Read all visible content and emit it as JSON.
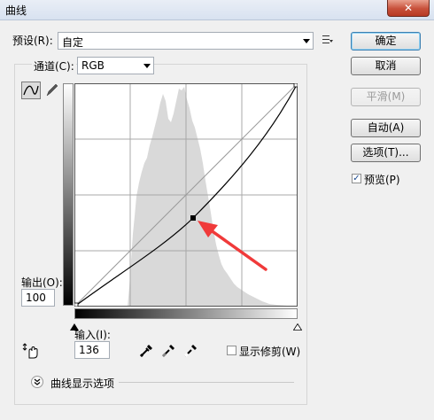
{
  "window": {
    "title": "曲线",
    "close_glyph": "✕"
  },
  "preset": {
    "label": "预设(R):",
    "value": "自定"
  },
  "channel": {
    "label": "通道(C):",
    "value": "RGB"
  },
  "output": {
    "label": "输出(O):",
    "value": "100"
  },
  "input": {
    "label": "输入(I):",
    "value": "136"
  },
  "clipping": {
    "label": "显示修剪(W)",
    "checked": false
  },
  "curve_options": {
    "label": "曲线显示选项"
  },
  "buttons": {
    "ok": "确定",
    "cancel": "取消",
    "smooth": "平滑(M)",
    "auto": "自动(A)",
    "options": "选项(T)..."
  },
  "preview": {
    "label": "预览(P)",
    "checked": true
  },
  "colors": {
    "accent_arrow": "#f03a3a",
    "histogram": "#d8d8d8"
  }
}
